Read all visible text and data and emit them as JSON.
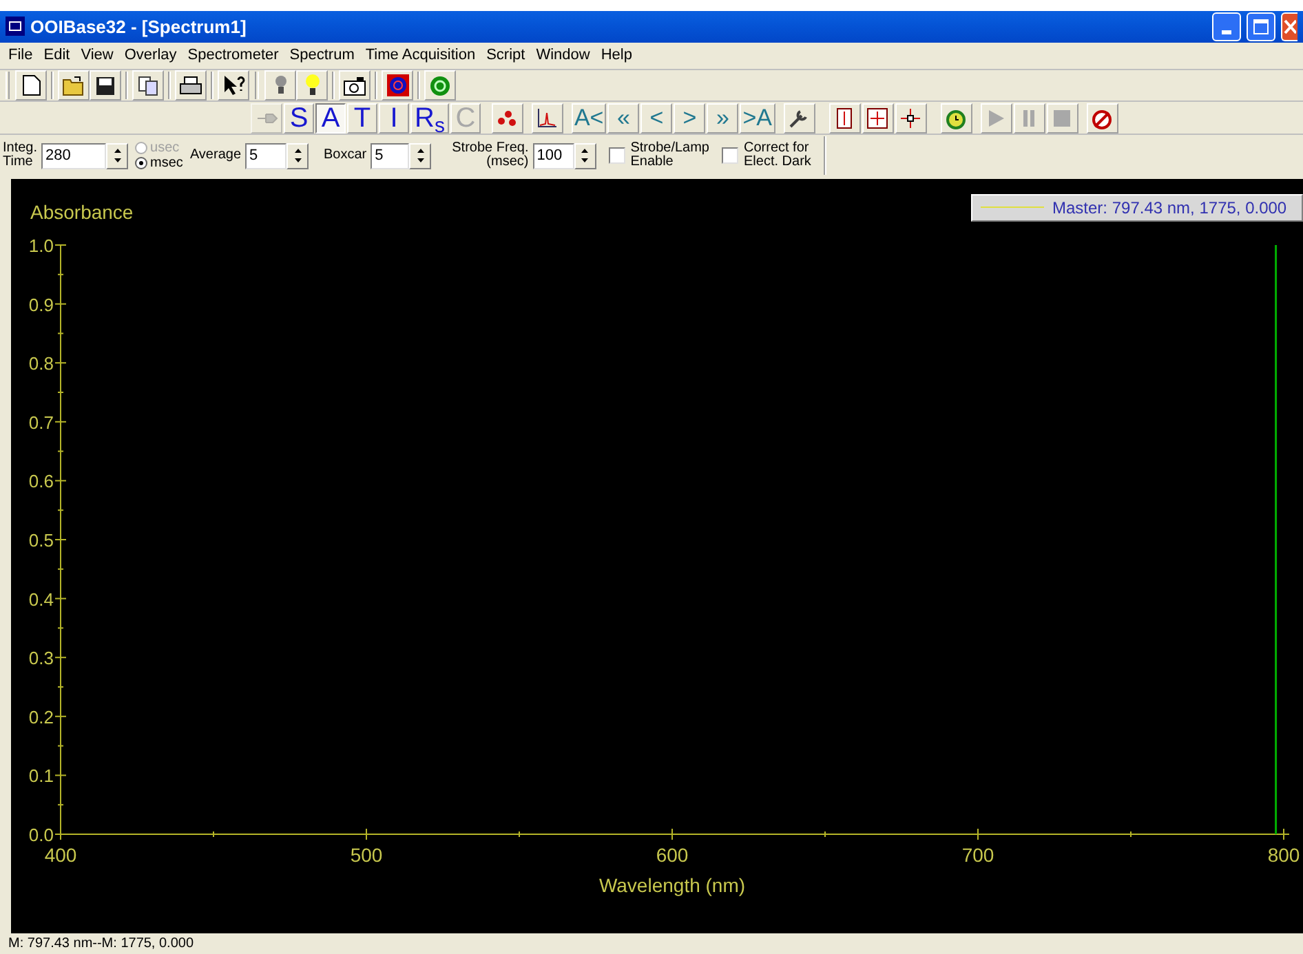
{
  "window": {
    "title": "OOIBase32 - [Spectrum1]"
  },
  "menu": [
    {
      "label": "File"
    },
    {
      "label": "Edit"
    },
    {
      "label": "View"
    },
    {
      "label": "Overlay"
    },
    {
      "label": "Spectrometer"
    },
    {
      "label": "Spectrum"
    },
    {
      "label": "Time Acquisition"
    },
    {
      "label": "Script"
    },
    {
      "label": "Window"
    },
    {
      "label": "Help"
    }
  ],
  "mode_buttons": [
    {
      "label": "S",
      "selected": false,
      "disabled": false
    },
    {
      "label": "A",
      "selected": true,
      "disabled": false
    },
    {
      "label": "T",
      "selected": false,
      "disabled": false
    },
    {
      "label": "I",
      "selected": false,
      "disabled": false
    },
    {
      "label": "R$_{s}$",
      "selected": false,
      "disabled": false
    },
    {
      "label": "C",
      "selected": false,
      "disabled": true
    }
  ],
  "nav_buttons": [
    {
      "label": "A<"
    },
    {
      "label": "«"
    },
    {
      "label": "<"
    },
    {
      "label": ">"
    },
    {
      "label": "»"
    },
    {
      "label": ">A"
    }
  ],
  "lamp_button": {
    "disabled": true
  },
  "acquisition_buttons": [
    {
      "disabled": true
    },
    {
      "disabled": true
    },
    {
      "disabled": true
    }
  ],
  "params": {
    "integ_label": "Integ.\nTime",
    "integ_value": "280",
    "units": [
      {
        "label": "usec",
        "selected": false,
        "disabled": true
      },
      {
        "label": "msec",
        "selected": true,
        "disabled": false
      }
    ],
    "average_label": "Average",
    "average_value": "5",
    "boxcar_label": "Boxcar",
    "boxcar_value": "5",
    "strobe_label": "Strobe Freq.\n(msec)",
    "strobe_value": "100",
    "checks": [
      {
        "label": "Strobe/Lamp\nEnable",
        "checked": false
      },
      {
        "label": "Correct for\nElect. Dark",
        "checked": false
      }
    ]
  },
  "plot": {
    "legend": "Master: 797.43 nm, 1775, 0.000",
    "chart_data": {
      "type": "line",
      "xlabel": "Wavelength (nm)",
      "ylabel": "Absorbance",
      "xlim": [
        400,
        800
      ],
      "ylim": [
        0,
        1
      ],
      "xticks": [
        {
          "value": 400,
          "label": "400"
        },
        {
          "value": 500,
          "label": "500"
        },
        {
          "value": 600,
          "label": "600"
        },
        {
          "value": 700,
          "label": "700"
        },
        {
          "value": 800,
          "label": "800"
        }
      ],
      "yticks": [
        {
          "value": 0,
          "label": "0.0"
        },
        {
          "value": 0.1,
          "label": "0.1"
        },
        {
          "value": 0.2,
          "label": "0.2"
        },
        {
          "value": 0.3,
          "label": "0.3"
        },
        {
          "value": 0.4,
          "label": "0.4"
        },
        {
          "value": 0.5,
          "label": "0.5"
        },
        {
          "value": 0.6,
          "label": "0.6"
        },
        {
          "value": 0.7,
          "label": "0.7"
        },
        {
          "value": 0.8,
          "label": "0.8"
        },
        {
          "value": 0.9,
          "label": "0.9"
        },
        {
          "value": 1,
          "label": "1.0"
        }
      ],
      "ref_lines": [
        {
          "axis": "x",
          "value": 797.43,
          "color": "#00b000"
        }
      ]
    }
  },
  "status_bar": "M: 797.43 nm--M: 1775, 0.000"
}
